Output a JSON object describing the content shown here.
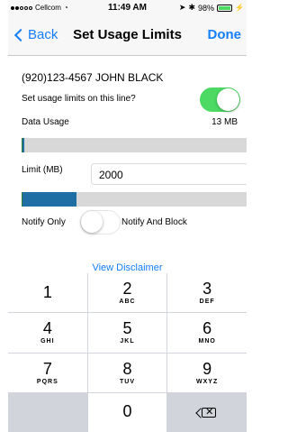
{
  "status_bar": {
    "carrier": "Cellcom",
    "time": "11:49 AM",
    "battery": "98%",
    "battery_level": 0.98
  },
  "nav": {
    "back_label": "Back",
    "title": "Set Usage Limits",
    "done_label": "Done"
  },
  "line": {
    "title": "(920)123-4567  JOHN BLACK"
  },
  "usage_limits": {
    "toggle_label": "Set usage limits on this line?",
    "toggle_on": true,
    "data_usage_label": "Data Usage",
    "data_usage_value": "13 MB",
    "data_usage_fraction": 0.0065,
    "limit_label": "Limit (MB)",
    "limit_value": "2000",
    "limit_bar_fraction": 0.24
  },
  "notify": {
    "left_label": "Notify Only",
    "right_label": "Notify And Block",
    "toggle_on": false
  },
  "disclaimer_link": "View Disclaimer",
  "keypad": {
    "keys": [
      {
        "num": "1",
        "letters": ""
      },
      {
        "num": "2",
        "letters": "ABC"
      },
      {
        "num": "3",
        "letters": "DEF"
      },
      {
        "num": "4",
        "letters": "GHI"
      },
      {
        "num": "5",
        "letters": "JKL"
      },
      {
        "num": "6",
        "letters": "MNO"
      },
      {
        "num": "7",
        "letters": "PQRS"
      },
      {
        "num": "8",
        "letters": "TUV"
      },
      {
        "num": "9",
        "letters": "WXYZ"
      },
      {
        "num": "0",
        "letters": ""
      }
    ]
  },
  "colors": {
    "accent": "#157efb",
    "toggle_on": "#4cd964",
    "limit_bar": "#1f6fa5"
  }
}
